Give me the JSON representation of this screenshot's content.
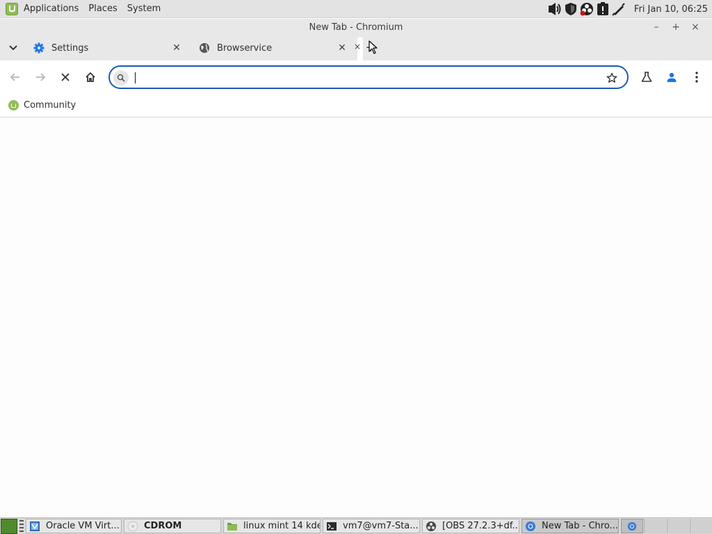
{
  "top_panel": {
    "menus": [
      "Applications",
      "Places",
      "System"
    ],
    "clock": "Fri Jan 10, 06:25",
    "tray_icons": [
      "volume-icon",
      "shield-icon",
      "obs-recording-icon",
      "clipboard-alert-icon",
      "pen-icon"
    ]
  },
  "window": {
    "title": "New Tab - Chromium",
    "controls": {
      "minimize": "–",
      "maximize": "+",
      "close": "×"
    }
  },
  "tabs": [
    {
      "label": "Settings",
      "icon": "gear-icon",
      "icon_color": "#1a73e8"
    },
    {
      "label": "Browservice",
      "icon": "globe-icon"
    }
  ],
  "new_tab_label": "+",
  "toolbar": {
    "omnibox_value": "",
    "omnibox_placeholder": ""
  },
  "bookmarks": [
    {
      "label": "Community",
      "icon": "mint-logo-icon"
    }
  ],
  "taskbar": {
    "tasks": [
      {
        "label": "Oracle VM Virt...",
        "icon": "virtualbox-icon"
      },
      {
        "label": "CDROM",
        "icon": "cdrom-icon"
      },
      {
        "label": "linux mint 14 kde",
        "icon": "folder-icon"
      },
      {
        "label": "vm7@vm7-Sta...",
        "icon": "terminal-icon"
      },
      {
        "label": "[OBS 27.2.3+df...",
        "icon": "obs-icon"
      },
      {
        "label": "New Tab - Chro...",
        "icon": "chromium-icon"
      }
    ]
  },
  "colors": {
    "accent_focus": "#1a58b8",
    "mint_green": "#8fbc5a",
    "profile_blue": "#1a73e8"
  }
}
